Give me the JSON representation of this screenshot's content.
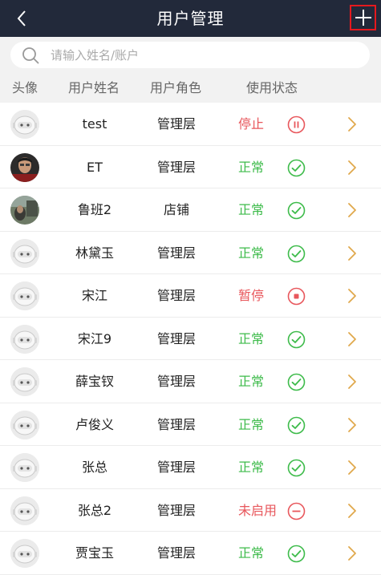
{
  "header": {
    "title": "用户管理"
  },
  "search": {
    "placeholder": "请输入姓名/账户"
  },
  "columns": [
    "头像",
    "用户姓名",
    "用户角色",
    "使用状态"
  ],
  "colors": {
    "header_bg": "#22293a",
    "status_normal": "#3dbb4a",
    "status_inactive": "#e8575c",
    "chevron": "#e0a84c",
    "add_highlight": "#e5191e"
  },
  "users": [
    {
      "avatar": "default-robot-avatar",
      "name": "test",
      "role": "管理层",
      "status": "停止",
      "status_type": "stopped",
      "status_icon": "pause-circle-icon"
    },
    {
      "avatar": "photo-avatar",
      "name": "ET",
      "role": "管理层",
      "status": "正常",
      "status_type": "normal",
      "status_icon": "check-circle-icon"
    },
    {
      "avatar": "photo-avatar",
      "name": "鲁班2",
      "role": "店铺",
      "status": "正常",
      "status_type": "normal",
      "status_icon": "check-circle-icon"
    },
    {
      "avatar": "default-robot-avatar",
      "name": "林黛玉",
      "role": "管理层",
      "status": "正常",
      "status_type": "normal",
      "status_icon": "check-circle-icon"
    },
    {
      "avatar": "default-robot-avatar",
      "name": "宋江",
      "role": "管理层",
      "status": "暂停",
      "status_type": "paused",
      "status_icon": "stop-circle-icon"
    },
    {
      "avatar": "default-robot-avatar",
      "name": "宋江9",
      "role": "管理层",
      "status": "正常",
      "status_type": "normal",
      "status_icon": "check-circle-icon"
    },
    {
      "avatar": "default-robot-avatar",
      "name": "薛宝钗",
      "role": "管理层",
      "status": "正常",
      "status_type": "normal",
      "status_icon": "check-circle-icon"
    },
    {
      "avatar": "default-robot-avatar",
      "name": "卢俊义",
      "role": "管理层",
      "status": "正常",
      "status_type": "normal",
      "status_icon": "check-circle-icon"
    },
    {
      "avatar": "default-robot-avatar",
      "name": "张总",
      "role": "管理层",
      "status": "正常",
      "status_type": "normal",
      "status_icon": "check-circle-icon"
    },
    {
      "avatar": "default-robot-avatar",
      "name": "张总2",
      "role": "管理层",
      "status": "未启用",
      "status_type": "disabled",
      "status_icon": "minus-circle-icon"
    },
    {
      "avatar": "default-robot-avatar",
      "name": "贾宝玉",
      "role": "管理层",
      "status": "正常",
      "status_type": "normal",
      "status_icon": "check-circle-icon"
    }
  ]
}
